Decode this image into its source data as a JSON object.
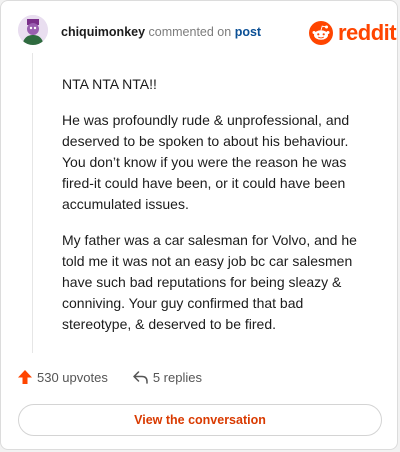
{
  "header": {
    "username": "chiquimonkey",
    "action_text": "commented on",
    "target_link": "post",
    "brand_name": "reddit"
  },
  "comment": {
    "paragraphs": [
      "NTA NTA NTA!!",
      "He was profoundly rude & unprofessional, and deserved to be spoken to about his behaviour. You don’t know if you were the reason he was fired-it could have been, or it could have been accumulated issues.",
      "My father was a car salesman for Volvo, and he told me it was not an easy job bc car salesmen have such bad reputations for being sleazy & conniving. Your guy confirmed that bad stereotype, & deserved to be fired."
    ]
  },
  "actions": {
    "upvotes": "530 upvotes",
    "replies": "5 replies"
  },
  "footer": {
    "view_label": "View the conversation"
  },
  "icons": {
    "upvote": "upvote-arrow-icon",
    "reply": "reply-arrow-icon",
    "logo": "reddit-snoo-icon",
    "avatar": "user-avatar"
  },
  "colors": {
    "brand": "#ff4500",
    "link": "#0a4f95",
    "button_text": "#d93a00"
  }
}
